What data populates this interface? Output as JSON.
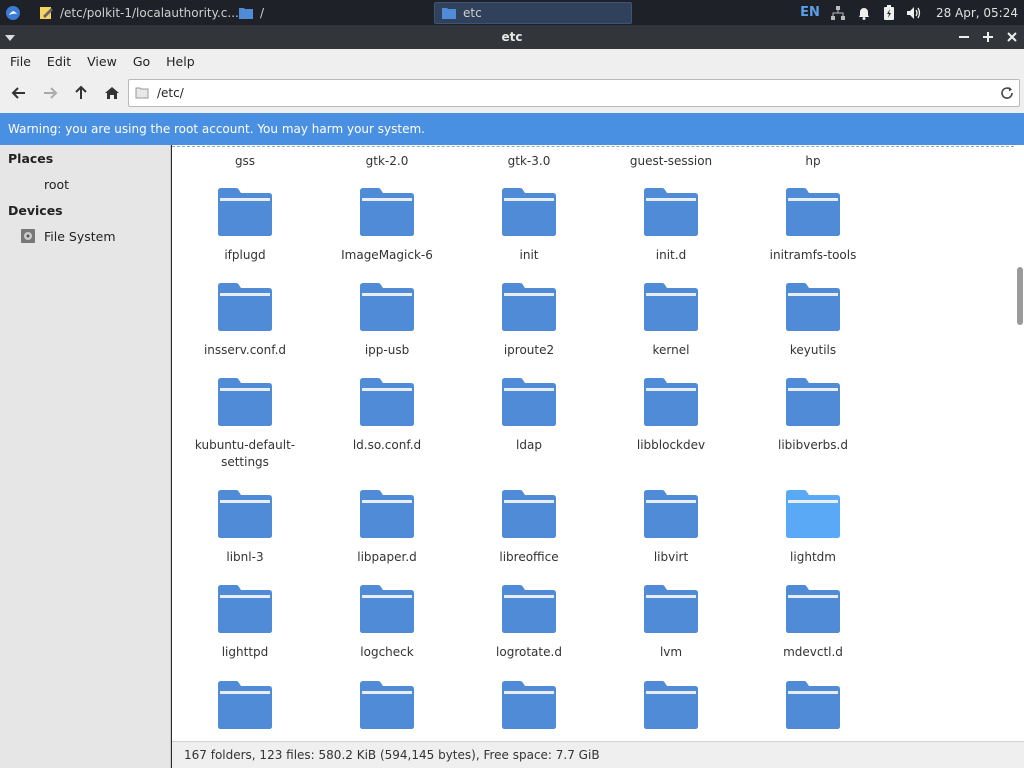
{
  "taskbar": {
    "tasks": [
      {
        "label": "/etc/polkit-1/localauthority.c..."
      },
      {
        "label": "/"
      },
      {
        "label": "etc"
      }
    ],
    "lang": "EN",
    "clock": "28 Apr, 05:24"
  },
  "window": {
    "title": "etc"
  },
  "menubar": {
    "items": [
      "File",
      "Edit",
      "View",
      "Go",
      "Help"
    ]
  },
  "location": {
    "path": "/etc/"
  },
  "warning": "Warning: you are using the root account. You may harm your system.",
  "sidebar": {
    "places_heading": "Places",
    "places": [
      {
        "label": "root"
      }
    ],
    "devices_heading": "Devices",
    "devices": [
      {
        "label": "File System"
      }
    ]
  },
  "files": {
    "top_row": [
      "gss",
      "gtk-2.0",
      "gtk-3.0",
      "guest-session",
      "hp"
    ],
    "rows": [
      [
        "ifplugd",
        "ImageMagick-6",
        "init",
        "init.d",
        "initramfs-tools"
      ],
      [
        "insserv.conf.d",
        "ipp-usb",
        "iproute2",
        "kernel",
        "keyutils"
      ],
      [
        "kubuntu-default-settings",
        "ld.so.conf.d",
        "ldap",
        "libblockdev",
        "libibverbs.d"
      ],
      [
        "libnl-3",
        "libpaper.d",
        "libreoffice",
        "libvirt",
        "lightdm"
      ],
      [
        "lighttpd",
        "logcheck",
        "logrotate.d",
        "lvm",
        "mdevctl.d"
      ]
    ],
    "highlighted": "lightdm"
  },
  "colors": {
    "folder": "#4f8bd6",
    "folder_highlight": "#5aa9f5",
    "accent": "#4a90e2"
  },
  "status": "167 folders, 123 files: 580.2 KiB (594,145 bytes), Free space: 7.7 GiB"
}
